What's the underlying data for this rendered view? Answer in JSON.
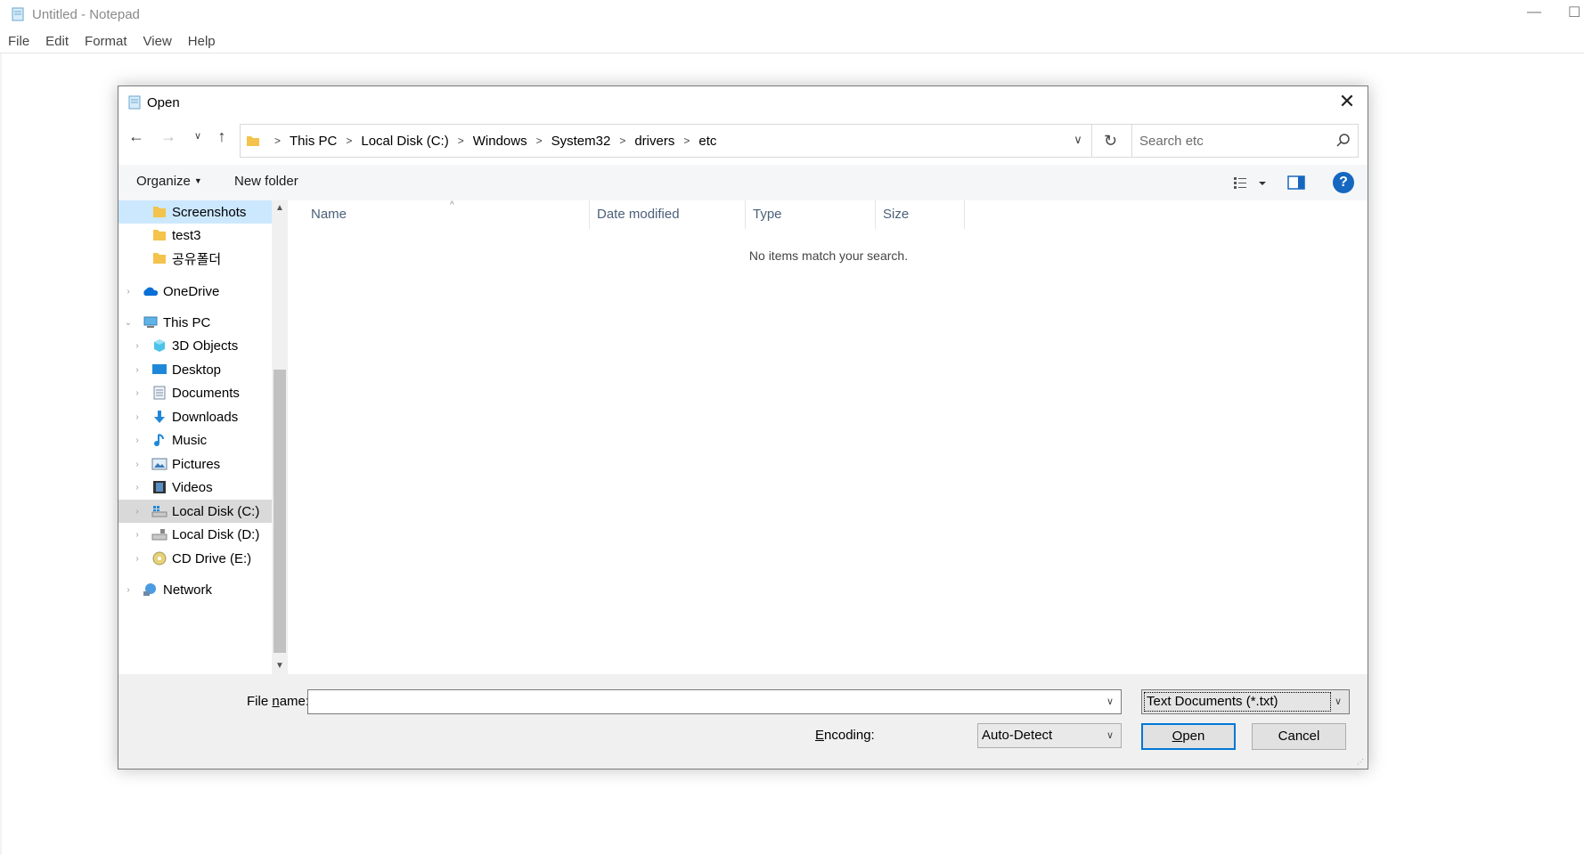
{
  "notepad": {
    "title": "Untitled - Notepad",
    "menu": [
      "File",
      "Edit",
      "Format",
      "View",
      "Help"
    ],
    "minimize_glyph": "—",
    "maximize_glyph": "☐"
  },
  "dialog": {
    "title": "Open",
    "close_glyph": "✕",
    "breadcrumbs": [
      "This PC",
      "Local Disk (C:)",
      "Windows",
      "System32",
      "drivers",
      "etc"
    ],
    "search_placeholder": "Search etc",
    "toolbar": {
      "organize_label": "Organize",
      "new_folder_label": "New folder"
    },
    "help_glyph": "?",
    "nav_items": [
      {
        "label": "Screenshots",
        "icon": "folder-icon"
      },
      {
        "label": "test3",
        "icon": "folder-icon"
      },
      {
        "label": "공유폴더",
        "icon": "folder-icon"
      },
      {
        "label": "OneDrive",
        "icon": "onedrive-icon"
      },
      {
        "label": "This PC",
        "icon": "this-pc-icon"
      },
      {
        "label": "3D Objects",
        "icon": "3d-objects-icon"
      },
      {
        "label": "Desktop",
        "icon": "desktop-icon"
      },
      {
        "label": "Documents",
        "icon": "documents-icon"
      },
      {
        "label": "Downloads",
        "icon": "downloads-icon"
      },
      {
        "label": "Music",
        "icon": "music-icon"
      },
      {
        "label": "Pictures",
        "icon": "pictures-icon"
      },
      {
        "label": "Videos",
        "icon": "videos-icon"
      },
      {
        "label": "Local Disk (C:)",
        "icon": "local-disk-c-icon"
      },
      {
        "label": "Local Disk (D:)",
        "icon": "local-disk-d-icon"
      },
      {
        "label": "CD Drive (E:)",
        "icon": "cd-drive-icon"
      },
      {
        "label": "Network",
        "icon": "network-icon"
      }
    ],
    "columns": [
      "Name",
      "Date modified",
      "Type",
      "Size"
    ],
    "empty_message": "No items match your search.",
    "file_name_label_pre": "File ",
    "file_name_label_u": "n",
    "file_name_label_post": "ame:",
    "file_name_value": "",
    "file_type_value": "Text Documents (*.txt)",
    "encoding_label_u": "E",
    "encoding_label_post": "ncoding:",
    "encoding_value": "Auto-Detect",
    "open_label_u": "O",
    "open_label_post": "pen",
    "cancel_label": "Cancel"
  },
  "colors": {
    "accent": "#0078d7",
    "selected_bg": "#cce8ff",
    "folder": "#f3c34c",
    "help": "#1667c0"
  }
}
